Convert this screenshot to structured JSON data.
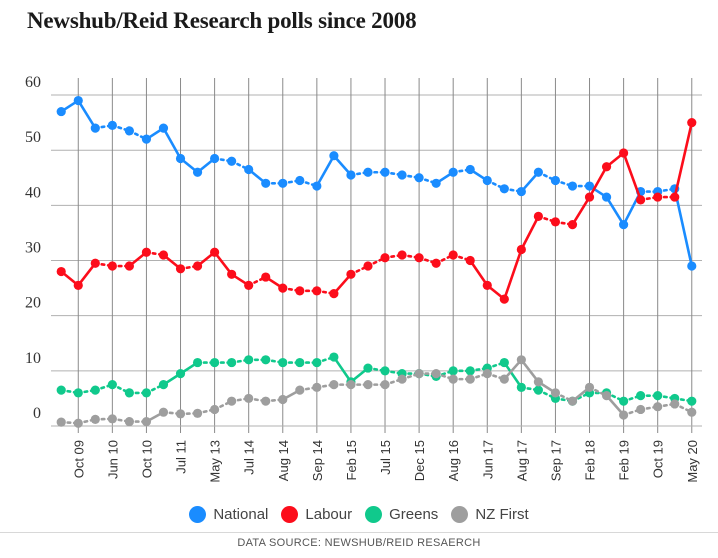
{
  "title": "Newshub/Reid Research polls since 2008",
  "source_note": "DATA SOURCE: NEWSHUB/REID RESAERCH",
  "legend": {
    "items": [
      {
        "label": "National",
        "color": "#1a8cff"
      },
      {
        "label": "Labour",
        "color": "#fc0d1b"
      },
      {
        "label": "Greens",
        "color": "#10c98c"
      },
      {
        "label": "NZ First",
        "color": "#9e9e9e"
      }
    ]
  },
  "chart_data": {
    "type": "line",
    "title": "Newshub/Reid Research polls since 2008",
    "xlabel": "",
    "ylabel": "",
    "ylim": [
      0,
      62
    ],
    "yticks": [
      0,
      10,
      20,
      30,
      40,
      50,
      60
    ],
    "grid": true,
    "legend_position": "bottom",
    "xtick_labels": [
      "Oct 09",
      "Jun 10",
      "Oct 10",
      "Jul 11",
      "May 13",
      "Jul 14",
      "Aug 14",
      "Sep 14",
      "Feb 15",
      "Jul 15",
      "Dec 15",
      "Aug 16",
      "Jun 17",
      "Aug 17",
      "Sep 17",
      "Feb 18",
      "Feb 19",
      "Oct 19",
      "May 20"
    ],
    "xtick_indices": [
      1,
      3,
      5,
      7,
      9,
      11,
      13,
      15,
      17,
      19,
      21,
      23,
      25,
      27,
      29,
      31,
      33,
      35,
      37
    ],
    "series": [
      {
        "name": "National",
        "color": "#1a8cff",
        "values": [
          57,
          59,
          54,
          54.5,
          53.5,
          52,
          54,
          48.5,
          46,
          48.5,
          48,
          46.5,
          44,
          44,
          44.5,
          43.5,
          49,
          45.5,
          46,
          46,
          45.5,
          45,
          44,
          46,
          46.5,
          44.5,
          43,
          42.5,
          46,
          44.5,
          43.5,
          43.5,
          41.5,
          36.5,
          42.5,
          42.5,
          43,
          29
        ]
      },
      {
        "name": "Labour",
        "color": "#fc0d1b",
        "values": [
          28,
          25.5,
          29.5,
          29,
          29,
          31.5,
          31,
          28.5,
          29,
          31.5,
          27.5,
          25.5,
          27,
          25,
          24.5,
          24.5,
          24,
          27.5,
          29,
          30.5,
          31,
          30.5,
          29.5,
          31,
          30,
          25.5,
          23,
          32,
          38,
          37,
          36.5,
          41.5,
          47,
          49.5,
          41,
          41.5,
          41.5,
          55
        ]
      },
      {
        "name": "Greens",
        "color": "#10c98c",
        "values": [
          6.5,
          6,
          6.5,
          7.5,
          6,
          6,
          7.5,
          9.5,
          11.5,
          11.5,
          11.5,
          12,
          12,
          11.5,
          11.5,
          11.5,
          12.5,
          8,
          10.5,
          10,
          9.5,
          9.5,
          9,
          10,
          10,
          10.5,
          11.5,
          7,
          6.5,
          5,
          4.5,
          6,
          6,
          4.5,
          5.5,
          5.5,
          5,
          4.5
        ]
      },
      {
        "name": "NZ First",
        "color": "#9e9e9e",
        "values": [
          0.7,
          0.5,
          1.2,
          1.3,
          0.8,
          0.8,
          2.5,
          2.2,
          2.3,
          3,
          4.5,
          5,
          4.5,
          4.8,
          6.5,
          7,
          7.5,
          7.5,
          7.5,
          7.5,
          8.5,
          9.5,
          9.5,
          8.5,
          8.5,
          9.5,
          8.5,
          12,
          8,
          6,
          4.5,
          7,
          5.5,
          2,
          3,
          3.5,
          4,
          2.5
        ]
      }
    ]
  }
}
